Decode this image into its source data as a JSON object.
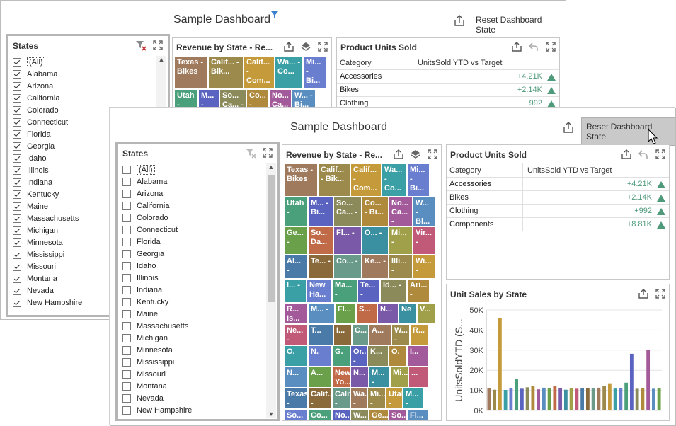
{
  "back_window": {
    "title": "Sample Dashboard",
    "reset_label": "Reset Dashboard State",
    "states_panel": {
      "title": "States",
      "items": [
        {
          "label": "(All)",
          "checked": true
        },
        {
          "label": "Alabama",
          "checked": true
        },
        {
          "label": "Arizona",
          "checked": true
        },
        {
          "label": "California",
          "checked": true
        },
        {
          "label": "Colorado",
          "checked": true
        },
        {
          "label": "Connecticut",
          "checked": true
        },
        {
          "label": "Florida",
          "checked": true
        },
        {
          "label": "Georgia",
          "checked": true
        },
        {
          "label": "Idaho",
          "checked": true
        },
        {
          "label": "Illinois",
          "checked": true
        },
        {
          "label": "Indiana",
          "checked": true
        },
        {
          "label": "Kentucky",
          "checked": true
        },
        {
          "label": "Maine",
          "checked": true
        },
        {
          "label": "Massachusetts",
          "checked": true
        },
        {
          "label": "Michigan",
          "checked": true
        },
        {
          "label": "Minnesota",
          "checked": true
        },
        {
          "label": "Mississippi",
          "checked": true
        },
        {
          "label": "Missouri",
          "checked": true
        },
        {
          "label": "Montana",
          "checked": true
        },
        {
          "label": "Nevada",
          "checked": true
        },
        {
          "label": "New Hampshire",
          "checked": true
        }
      ]
    },
    "revenue_panel": {
      "title": "Revenue by State - Re..."
    },
    "product_panel": {
      "title": "Product Units Sold",
      "col_category": "Category",
      "col_value": "UnitsSold YTD vs Target",
      "rows": [
        {
          "category": "Accessories",
          "value": "+4.21K"
        },
        {
          "category": "Bikes",
          "value": "+2.14K"
        },
        {
          "category": "Clothing",
          "value": "+992"
        }
      ]
    }
  },
  "front_window": {
    "title": "Sample Dashboard",
    "reset_label": "Reset Dashboard State",
    "states_panel": {
      "title": "States",
      "items": [
        {
          "label": "(All)",
          "checked": false
        },
        {
          "label": "Alabama",
          "checked": false
        },
        {
          "label": "Arizona",
          "checked": false
        },
        {
          "label": "California",
          "checked": false
        },
        {
          "label": "Colorado",
          "checked": false
        },
        {
          "label": "Connecticut",
          "checked": false
        },
        {
          "label": "Florida",
          "checked": false
        },
        {
          "label": "Georgia",
          "checked": false
        },
        {
          "label": "Idaho",
          "checked": false
        },
        {
          "label": "Illinois",
          "checked": false
        },
        {
          "label": "Indiana",
          "checked": false
        },
        {
          "label": "Kentucky",
          "checked": false
        },
        {
          "label": "Maine",
          "checked": false
        },
        {
          "label": "Massachusetts",
          "checked": false
        },
        {
          "label": "Michigan",
          "checked": false
        },
        {
          "label": "Minnesota",
          "checked": false
        },
        {
          "label": "Mississippi",
          "checked": false
        },
        {
          "label": "Missouri",
          "checked": false
        },
        {
          "label": "Montana",
          "checked": false
        },
        {
          "label": "Nevada",
          "checked": false
        },
        {
          "label": "New Hampshire",
          "checked": false
        }
      ]
    },
    "revenue_panel": {
      "title": "Revenue by State - Re..."
    },
    "product_panel": {
      "title": "Product Units Sold",
      "col_category": "Category",
      "col_value": "UnitsSold YTD vs Target",
      "rows": [
        {
          "category": "Accessories",
          "value": "+4.21K"
        },
        {
          "category": "Bikes",
          "value": "+2.14K"
        },
        {
          "category": "Clothing",
          "value": "+992"
        },
        {
          "category": "Components",
          "value": "+8.81K"
        }
      ]
    },
    "unit_sales_panel": {
      "title": "Unit Sales by State"
    }
  },
  "colors": {
    "tile_palette": [
      "#a07a5c",
      "#9c8a4c",
      "#c59a3a",
      "#3aa0a6",
      "#6a7ed0",
      "#4aa07a",
      "#5a64c0",
      "#8a8a5a",
      "#b08a3c",
      "#a35a9a",
      "#5a8ec0",
      "#6aa04a",
      "#c06a48",
      "#7a5aa8",
      "#3a90a0",
      "#a0a04a",
      "#c05a78",
      "#4a7aa8",
      "#8a6a3a",
      "#6a9a8a"
    ],
    "growth": "#4f9a7b"
  },
  "treemap_tiles": [
    "Texas - Bikes",
    "Calif... - Bik...",
    "Calif... - Com...",
    "Wa... - Co...",
    "Mi... - Bi...",
    "Utah -",
    "M... - Bi...",
    "So... Ca... -",
    "Co... - Bi...",
    "No... Ca... -",
    "W... - Bi...",
    "Ge... -",
    "So... Da...",
    "Fl... -",
    "O... -",
    "Mi... -",
    "Vir... -",
    "Al... -",
    "Te... -",
    "Co... -",
    "Ke... -",
    "Illi... -",
    "Wi... -",
    "I... -",
    "New Ha...",
    "Ma... -",
    "Te... -",
    "Id... -",
    "Ari... -",
    "R... Is...",
    "M... -",
    "Fl...",
    "S...",
    "N...",
    "Ne",
    "V...",
    "Ne... -",
    "T...",
    "I...",
    "C...",
    "A...",
    "W... -",
    "R...",
    "O.",
    "N.",
    "G.",
    "Or... -",
    "K...",
    "O.",
    "I...",
    "N...",
    "A...",
    "New Yo...",
    "N...",
    "M... -",
    "Mi...",
    "..."
  ],
  "chart_data": {
    "type": "bar",
    "title": "Unit Sales by State",
    "ylabel": "UnitsSoldYTD (S...",
    "ylim": [
      0,
      50000
    ],
    "yticks": [
      "0K",
      "10K",
      "20K",
      "30K",
      "40K",
      "50K"
    ],
    "values": [
      11200,
      10300,
      45800,
      10200,
      11000,
      15800,
      10800,
      11500,
      12000,
      10500,
      11300,
      11000,
      12300,
      11200,
      10300,
      11000,
      10800,
      11000,
      11200,
      11000,
      11300,
      12000,
      13500,
      10900,
      11000,
      13800,
      28200,
      10800,
      11000,
      30200,
      10800,
      11200
    ]
  }
}
